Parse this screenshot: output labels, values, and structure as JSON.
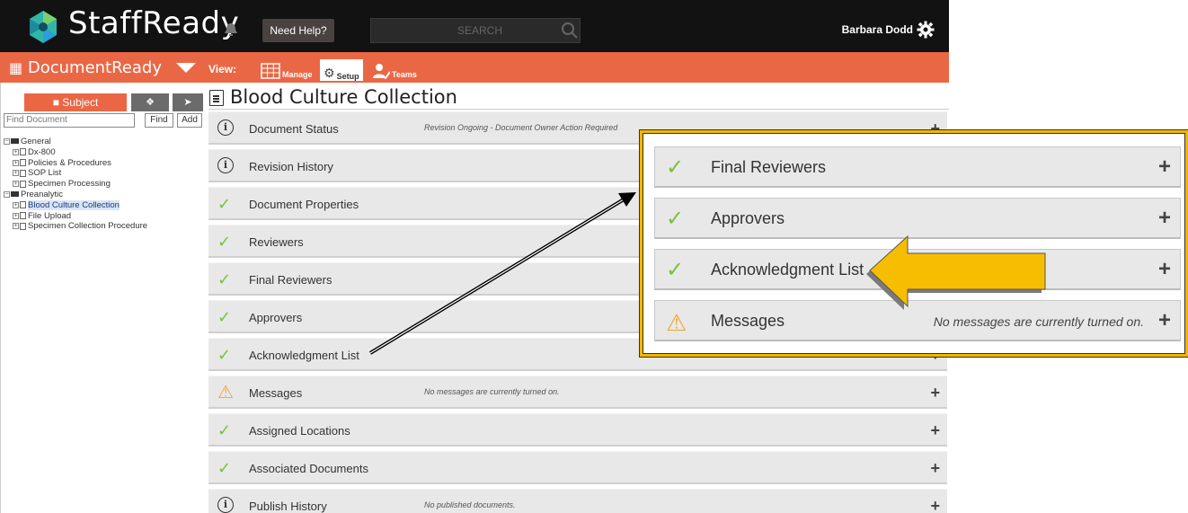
{
  "header": {
    "brand": "StaffReady",
    "help_label": "Need Help?",
    "search_placeholder": "SEARCH",
    "user_name": "Barbara Dodd"
  },
  "module_bar": {
    "module_name": "DocumentReady",
    "view_label": "View:",
    "views": [
      {
        "label": "Manage",
        "icon": "grid-icon",
        "active": false
      },
      {
        "label": "Setup",
        "icon": "gears-icon",
        "active": true
      },
      {
        "label": "Teams",
        "icon": "users-icon",
        "active": false
      }
    ]
  },
  "sidebar": {
    "subject_label": "Subject",
    "find_placeholder": "Find Document",
    "find_label": "Find",
    "add_label": "Add",
    "tree": [
      {
        "label": "General",
        "type": "folder",
        "level": 0
      },
      {
        "label": "Dx-800",
        "type": "doc",
        "level": 1
      },
      {
        "label": "Policies & Procedures",
        "type": "doc",
        "level": 1
      },
      {
        "label": "SOP List",
        "type": "doc",
        "level": 1
      },
      {
        "label": "Specimen Processing",
        "type": "doc",
        "level": 1
      },
      {
        "label": "Preanalytic",
        "type": "folder",
        "level": 0
      },
      {
        "label": "Blood Culture Collection",
        "type": "doc",
        "level": 1,
        "selected": true
      },
      {
        "label": "File Upload",
        "type": "doc",
        "level": 1
      },
      {
        "label": "Specimen Collection Procedure",
        "type": "doc",
        "level": 1
      }
    ]
  },
  "document": {
    "title": "Blood Culture Collection",
    "sections": [
      {
        "label": "Document Status",
        "status": "info",
        "note": "Revision Ongoing - Document Owner Action Required"
      },
      {
        "label": "Revision History",
        "status": "info",
        "note": ""
      },
      {
        "label": "Document Properties",
        "status": "check",
        "note": ""
      },
      {
        "label": "Reviewers",
        "status": "check",
        "note": ""
      },
      {
        "label": "Final Reviewers",
        "status": "check",
        "note": ""
      },
      {
        "label": "Approvers",
        "status": "check",
        "note": ""
      },
      {
        "label": "Acknowledgment List",
        "status": "check",
        "note": ""
      },
      {
        "label": "Messages",
        "status": "warning",
        "note": "No messages are currently turned on."
      },
      {
        "label": "Assigned Locations",
        "status": "check",
        "note": ""
      },
      {
        "label": "Associated Documents",
        "status": "check",
        "note": ""
      },
      {
        "label": "Publish History",
        "status": "info",
        "note": "No published documents."
      }
    ]
  },
  "zoom_callout": {
    "rows": [
      {
        "label": "Final Reviewers",
        "status": "check",
        "note": ""
      },
      {
        "label": "Approvers",
        "status": "check",
        "note": ""
      },
      {
        "label": "Acknowledgment List",
        "status": "check",
        "note": ""
      },
      {
        "label": "Messages",
        "status": "warning",
        "note": "No messages are currently turned on."
      }
    ]
  },
  "colors": {
    "topbar": "#121212",
    "accent_orange": "#ea6745",
    "check_green": "#7cbf3c",
    "warning_amber": "#f0a830",
    "callout_yellow": "#f2b600"
  }
}
